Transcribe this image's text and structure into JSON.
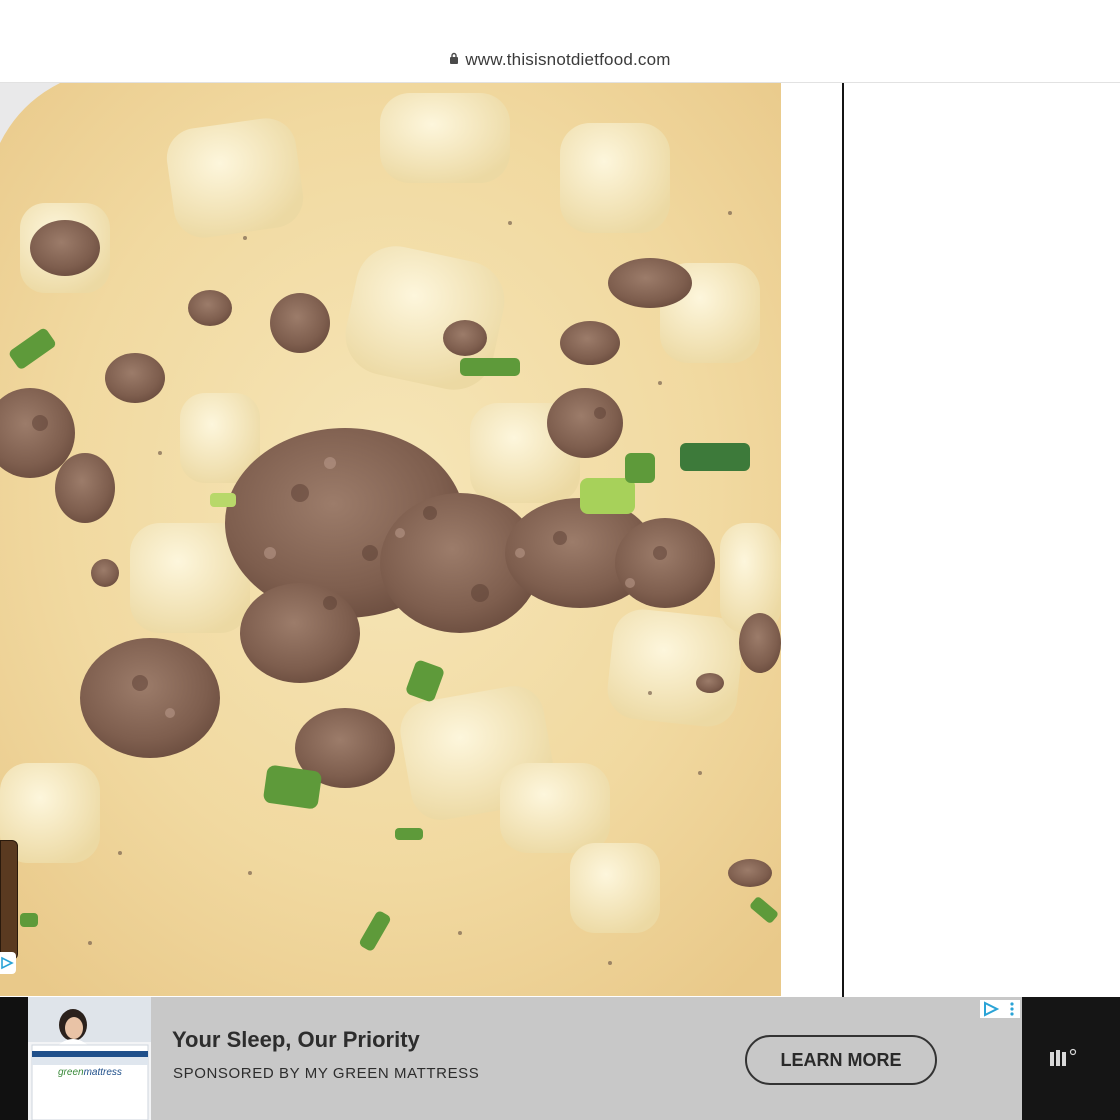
{
  "browser": {
    "url": "www.thisisnotdietfood.com"
  },
  "photo": {
    "alt_subject": "creamy potato soup with ground beef and green onions"
  },
  "ad": {
    "title": "Your Sleep, Our Priority",
    "sponsor": "SPONSORED BY MY GREEN MATTRESS",
    "cta_label": "LEARN MORE",
    "brand_mark": "mattress",
    "brand_prefix": "green"
  },
  "icons": {
    "lock": "lock-icon",
    "ad_choices": "ad-choices-icon",
    "ad_menu": "kebab-menu-icon",
    "publisher_logo": "publisher-logo-icon"
  },
  "colors": {
    "cream": "#f1dca6",
    "beef": "#8a6a58",
    "green_onion": "#5e9a3a",
    "ad_bg": "#c8c8c8"
  }
}
